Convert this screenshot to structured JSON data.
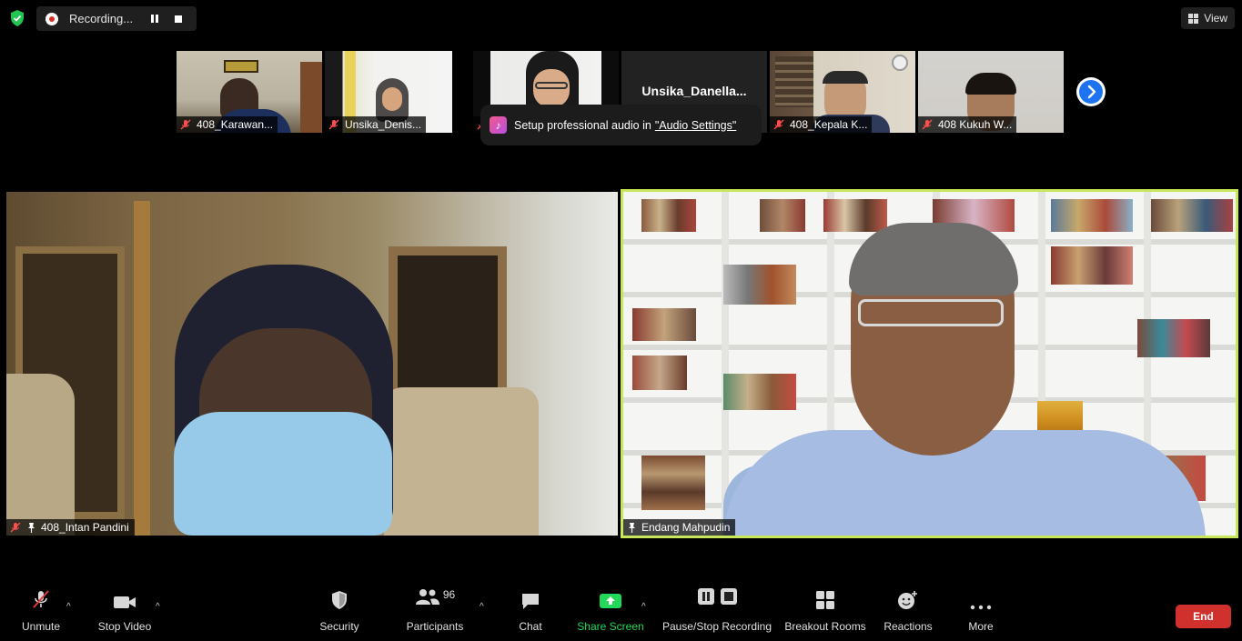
{
  "top_bar": {
    "recording_label": "Recording...",
    "view_label": "View"
  },
  "thumbnails": [
    {
      "name": "408_Karawan...",
      "muted": true
    },
    {
      "name": "Unsika_Denis...",
      "muted": true
    },
    {
      "name": "",
      "muted": true
    },
    {
      "name": "Unsika_Danella...",
      "muted": false,
      "video_off": true
    },
    {
      "name": "408_Kepala K...",
      "muted": true
    },
    {
      "name": "408 Kukuh W...",
      "muted": true
    }
  ],
  "tooltip": {
    "text": "Setup professional audio in",
    "link": "\"Audio Settings\""
  },
  "main_videos": {
    "left": {
      "name": "408_Intan Pandini",
      "muted": true,
      "pinned": true
    },
    "right": {
      "name": "Endang Mahpudin",
      "muted": false,
      "pinned": true,
      "active_speaker": true
    }
  },
  "toolbar": {
    "unmute": "Unmute",
    "stop_video": "Stop Video",
    "security": "Security",
    "participants": "Participants",
    "participants_count": "96",
    "chat": "Chat",
    "share_screen": "Share Screen",
    "pause_stop_recording": "Pause/Stop Recording",
    "breakout_rooms": "Breakout Rooms",
    "reactions": "Reactions",
    "more": "More",
    "end": "End"
  },
  "colors": {
    "active_speaker_border": "#c8e65a",
    "share_screen_green": "#23d959",
    "end_red": "#d0312d",
    "next_arrow_blue": "#1e74f0"
  }
}
